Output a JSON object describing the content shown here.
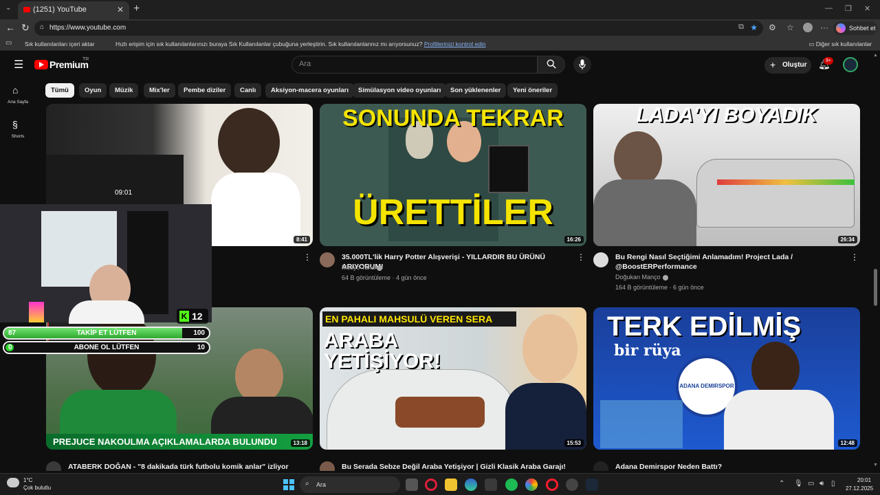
{
  "browser": {
    "tab_title": "(1251) YouTube",
    "url": "https://www.youtube.com",
    "copilot_label": "Sohbet et",
    "bookmarks": {
      "import_label": "Sık kullanılanları içeri aktar",
      "prompt_text": "Hızlı erişim için sık kullanılanlarınızı buraya Sık Kullanılanlar çubuğuna yerleştirin. Sık kullanılanlarınız mı arıyorsunuz?",
      "prompt_link": "Profillerinizi kontrol edin",
      "other_label": "Diğer sık kullanılanlar"
    }
  },
  "youtube": {
    "premium_label": "Premium",
    "region": "TR",
    "search_placeholder": "Ara",
    "create_label": "Oluştur",
    "notification_badge": "9+",
    "sidebar": [
      {
        "label": "Ana Sayfa",
        "icon": "home-icon"
      },
      {
        "label": "Shorts",
        "icon": "shorts-icon"
      }
    ],
    "chips": [
      "Tümü",
      "Oyun",
      "Müzik",
      "Mix'ler",
      "Pembe diziler",
      "Canlı",
      "Aksiyon-macera oyunları",
      "Simülasyon video oyunları",
      "Son yüklenenler",
      "Yeni öneriler"
    ],
    "videos": [
      {
        "title": "",
        "channel": "",
        "views": "",
        "duration": "8:41",
        "thumb_text": ""
      },
      {
        "title": "35.000TL'lik Harry Potter Alışverişi - YILLARDIR BU ÜRÜNÜ ARIYORUM!",
        "channel": "Mösyö Taha",
        "views": "64 B görüntüleme · 4 gün önce",
        "duration": "16:26",
        "thumb_text_top": "SONUNDA TEKRAR",
        "thumb_text_bottom": "ÜRETTİLER"
      },
      {
        "title": "Bu Rengi Nasıl Seçtiğimi Anlamadım! Project Lada / @BoostERPerformance",
        "channel": "Doğukan Manço",
        "views": "164 B görüntüleme · 6 gün önce",
        "duration": "26:34",
        "thumb_text": "LADA'YI BOYADIK"
      },
      {
        "title": "ATABERK DOĞAN - \"8 dakikada türk futbolu komik anlar\" izliyor",
        "channel": "",
        "views": "",
        "duration": "13:18",
        "thumb_text": "PREJUCE NAKOULMA AÇIKLAMALARDA BULUNDU"
      },
      {
        "title": "Bu Serada Sebze Değil Araba Yetişiyor | Gizli Klasik Araba Garajı!",
        "channel": "",
        "views": "",
        "duration": "15:53",
        "thumb_text_top": "EN PAHALI MAHSULÜ VEREN SERA",
        "thumb_text_bottom": "ARABA YETİŞİYOR!"
      },
      {
        "title": "Adana Demirspor Neden Battı?",
        "channel": "",
        "views": "",
        "duration": "12:48",
        "thumb_text_top": "TERK EDİLMİŞ",
        "thumb_text_bottom": "bir rüya",
        "thumb_badge": "ADANA DEMIRSPOR"
      }
    ],
    "overlay": {
      "clock": "09:01",
      "kick_count": "12",
      "goals": [
        {
          "left": "87",
          "label": "TAKİP ET LÜTFEN",
          "right": "100",
          "progress": 0.87
        },
        {
          "left": "0",
          "label": "ABONE OL LÜTFEN",
          "right": "10",
          "progress": 0.0
        }
      ]
    }
  },
  "taskbar": {
    "weather_temp": "1°C",
    "weather_desc": "Çok bulutlu",
    "search_text": "Ara",
    "time": "20:01",
    "date": "27.12.2025"
  }
}
